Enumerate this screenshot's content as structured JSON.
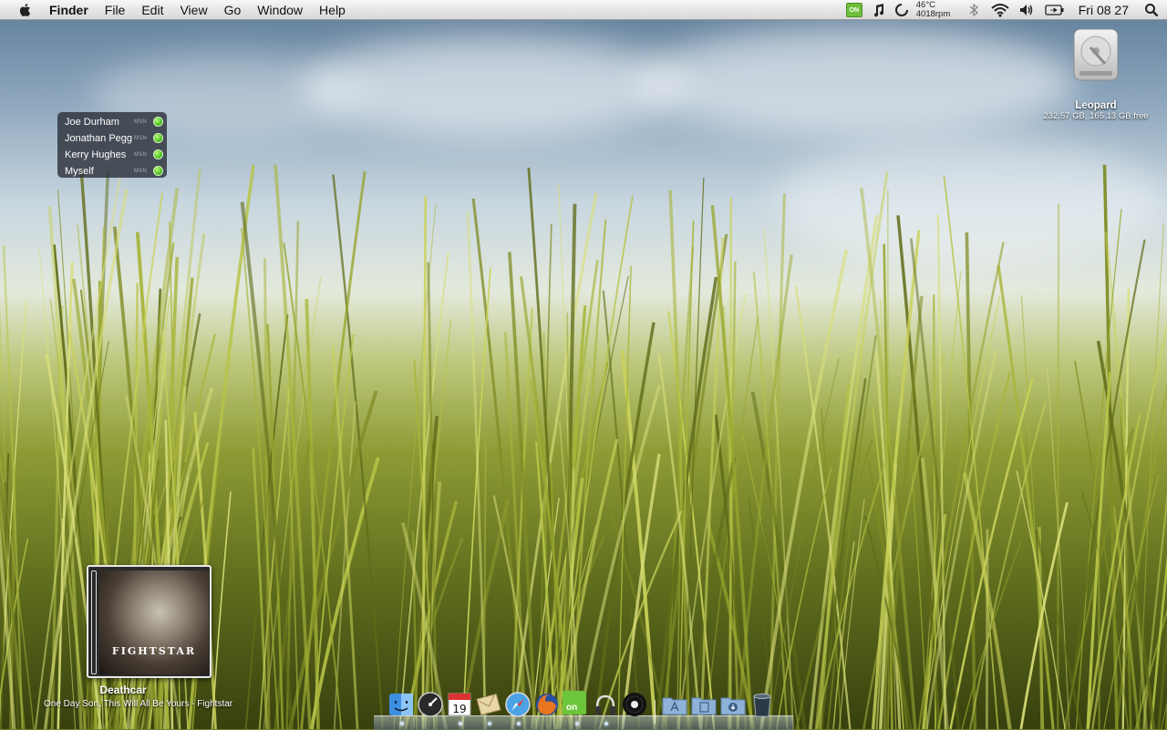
{
  "menubar": {
    "app_name": "Finder",
    "items": [
      "File",
      "Edit",
      "View",
      "Go",
      "Window",
      "Help"
    ],
    "tray": {
      "on_badge": "ON",
      "temperature": "46°C",
      "fan_speed": "4018rpm",
      "clock": "Fri 08 27"
    }
  },
  "desktop": {
    "drive": {
      "name": "Leopard",
      "info": "232.57 GB, 165.13 GB free"
    }
  },
  "contacts_widget": {
    "contacts": [
      {
        "name": "Joe Durham",
        "service": "MSN",
        "status": "online"
      },
      {
        "name": "Jonathan Pegg",
        "service": "MSN",
        "status": "online"
      },
      {
        "name": "Kerry Hughes",
        "service": "MSN",
        "status": "online"
      },
      {
        "name": "Myself",
        "service": "MSN",
        "status": "online"
      }
    ],
    "status_color": "#3cb414"
  },
  "now_playing": {
    "album_art_text": "FIGHTSTAR",
    "title": "Deathcar",
    "subtitle": "One Day Son, This Will All Be Yours - Fightstar"
  },
  "dock": {
    "on_tile_label": "on",
    "items": [
      "finder-icon",
      "dashboard-icon",
      "ical-icon",
      "mail-icon",
      "safari-icon",
      "firefox-icon",
      "adium-on-icon",
      "itunes-headphones-icon",
      "vinyl-icon",
      "applications-folder-icon",
      "documents-folder-icon",
      "downloads-folder-icon",
      "trash-icon"
    ]
  }
}
